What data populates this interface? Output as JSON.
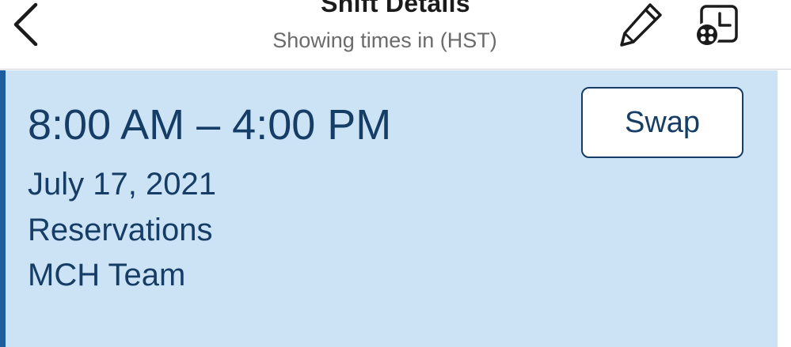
{
  "header": {
    "title": "Shift Details",
    "subtitle": "Showing times in (HST)",
    "icons": {
      "back": "chevron-left-icon",
      "edit": "pencil-icon",
      "schedule": "schedule-people-icon"
    }
  },
  "shift": {
    "time_range": "8:00 AM – 4:00 PM",
    "date": "July 17, 2021",
    "role": "Reservations",
    "team": "MCH Team",
    "swap_label": "Swap"
  },
  "colors": {
    "card_background": "#cce3f6",
    "accent_bar": "#1f5e9e",
    "text_primary": "#163d66"
  }
}
